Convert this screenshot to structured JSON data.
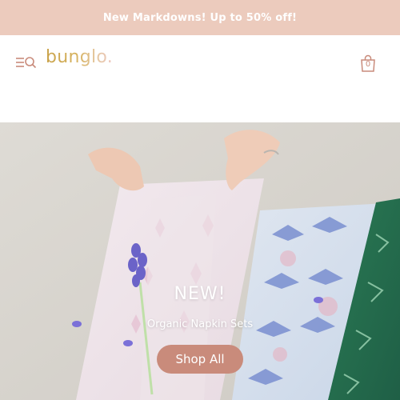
{
  "announcement": {
    "text": "New Markdowns! Up to 50% off!"
  },
  "header": {
    "logo_text": "bunglo.",
    "cart_count": "0"
  },
  "hero": {
    "headline": "NEW!",
    "subheadline": "Organic Napkin Sets",
    "cta_label": "Shop All"
  },
  "colors": {
    "announcement_bg": "#eccbbd",
    "accent": "#c98b7b",
    "logo_gold": "#c9a24a",
    "logo_pink": "#ecc6c0"
  },
  "icons": {
    "menu": "menu-search-icon",
    "cart": "shopping-bag-icon"
  }
}
